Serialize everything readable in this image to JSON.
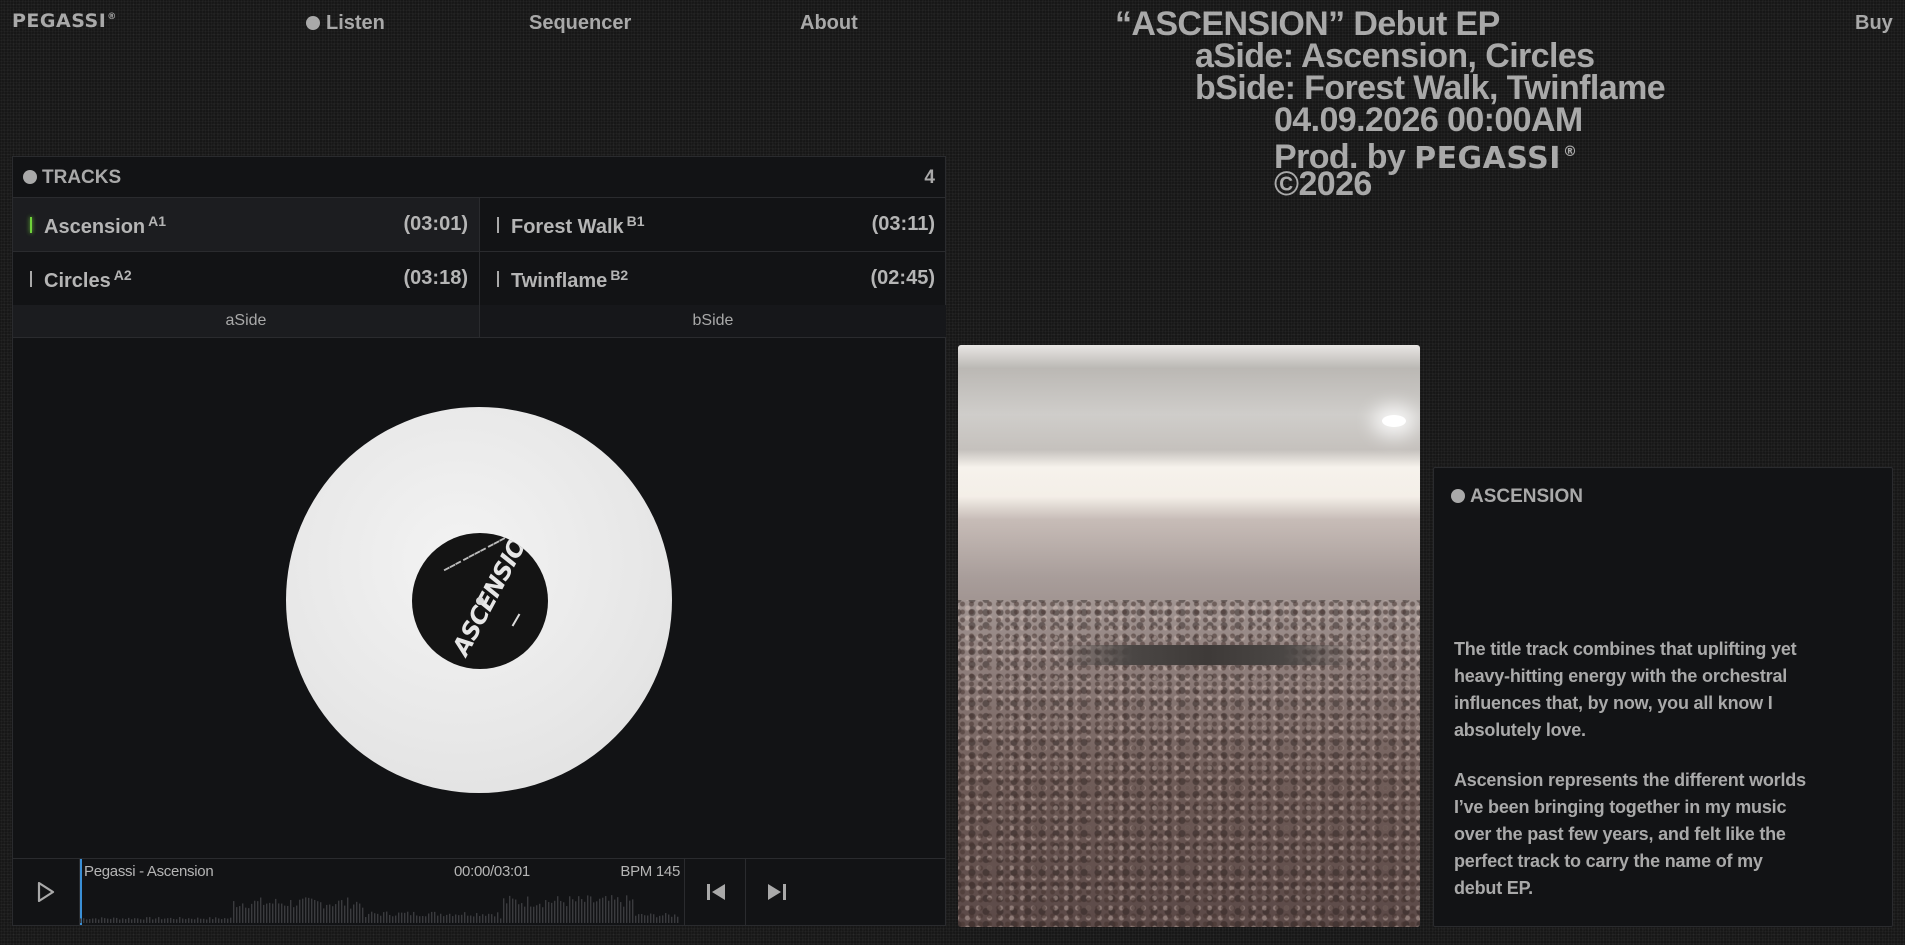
{
  "nav": {
    "logo": "PEGASSI",
    "logo_mark": "®",
    "links": [
      "Listen",
      "Sequencer",
      "About"
    ],
    "buy": "Buy"
  },
  "release": {
    "line1": "“ASCENSION” Debut EP",
    "line2": "aSide: Ascension, Circles",
    "line3": "bSide: Forest Walk, Twinflame",
    "line4": "04.09.2026 00:00AM",
    "prod_prefix": "Prod. by",
    "prod_name": "PEGASSI",
    "prod_mark": "®",
    "copyright": "©2026"
  },
  "tracks_panel": {
    "title": "TRACKS",
    "count": "4",
    "tracks": [
      {
        "name": "Ascension",
        "tag": "A1",
        "duration": "(03:01)"
      },
      {
        "name": "Forest Walk",
        "tag": "B1",
        "duration": "(03:11)"
      },
      {
        "name": "Circles",
        "tag": "A2",
        "duration": "(03:18)"
      },
      {
        "name": "Twinflame",
        "tag": "B2",
        "duration": "(02:45)"
      }
    ],
    "sides": [
      "aSide",
      "bSide"
    ]
  },
  "vinyl": {
    "label_text": "ASCENSION"
  },
  "player": {
    "title": "Pegassi - Ascension",
    "time": "00:00/03:01",
    "bpm": "BPM 145"
  },
  "description": {
    "title": "ASCENSION",
    "paragraphs": [
      "The title track combines that uplifting yet heavy-hitting energy with the orchestral influences that, by now, you all know I absolutely love.",
      "Ascension represents the different worlds I’ve been bringing together in my music over the past few years, and felt like the perfect track to carry the name of my debut EP."
    ]
  },
  "icons": {
    "play": "play-icon",
    "prev": "skip-back-icon",
    "next": "skip-forward-icon"
  },
  "colors": {
    "active_indicator": "#6fd23a",
    "progress_cursor": "#3a8fd6"
  }
}
